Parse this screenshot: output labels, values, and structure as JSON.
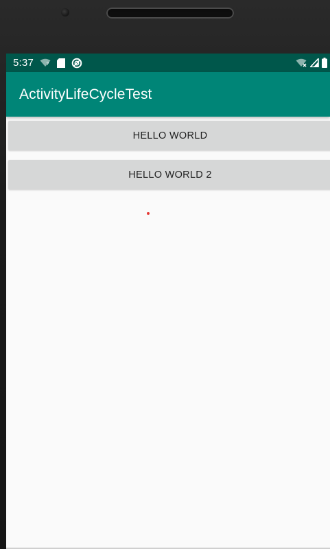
{
  "status_bar": {
    "time": "5:37",
    "left_icons": [
      "wifi-question-icon",
      "sd-card-icon",
      "sync-circle-icon"
    ],
    "right_icons": [
      "wifi-no-internet-icon",
      "cell-signal-icon",
      "battery-icon"
    ],
    "color": "#00574b"
  },
  "app_bar": {
    "title": "ActivityLifeCycleTest",
    "color": "#008577"
  },
  "buttons": [
    {
      "label": "HELLO WORLD"
    },
    {
      "label": "HELLO WORLD 2"
    }
  ],
  "colors": {
    "screen_background": "#fafafa",
    "button_background": "#d6d7d7",
    "dot": "#e53935"
  }
}
